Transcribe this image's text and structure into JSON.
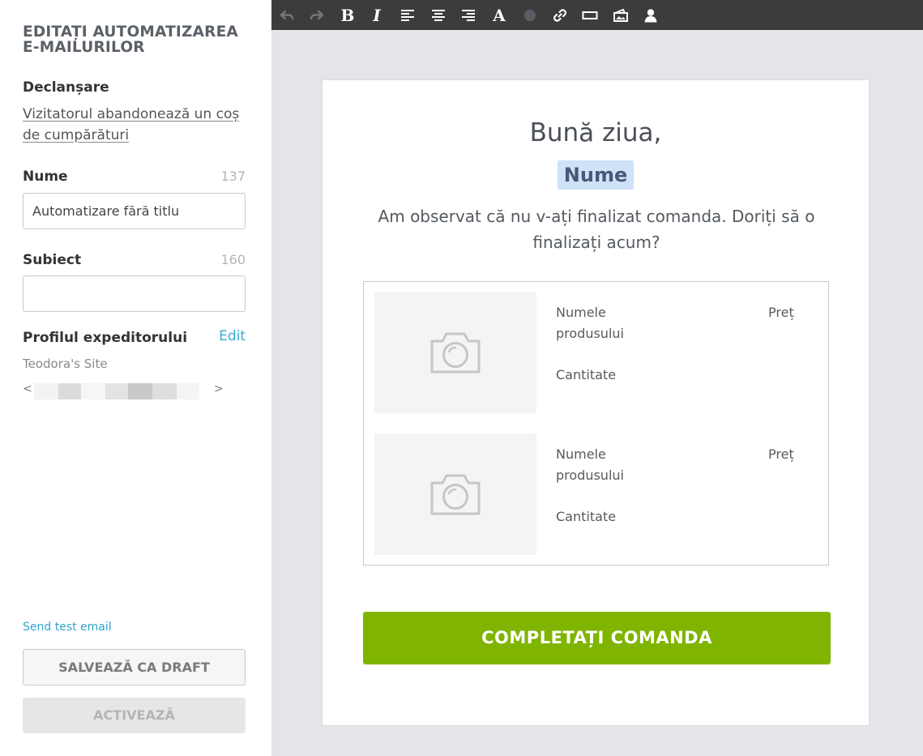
{
  "sidebar": {
    "title": "EDITAȚI AUTOMATIZAREA E-MAILURILOR",
    "trigger_label": "Declanșare",
    "trigger_value": "Vizitatorul abandonează un coș de cumpărături",
    "name_label": "Nume",
    "name_count": "137",
    "name_value": "Automatizare fără titlu",
    "subject_label": "Subiect",
    "subject_count": "160",
    "subject_value": "",
    "sender_label": "Profilul expeditorului",
    "sender_edit": "Edit",
    "sender_name": "Teodora's Site",
    "sender_email_open": "<",
    "sender_email_close": ">",
    "send_test": "Send test email",
    "save_draft": "SALVEAZĂ CA DRAFT",
    "activate": "ACTIVEAZĂ"
  },
  "toolbar": {
    "icons": [
      "undo-icon",
      "redo-icon",
      "bold-icon",
      "italic-icon",
      "align-left-icon",
      "align-center-icon",
      "align-right-icon",
      "font-size-icon",
      "text-color-icon",
      "link-icon",
      "button-icon",
      "image-icon",
      "user-icon"
    ],
    "text_color": "#5a5d63"
  },
  "email": {
    "greeting": "Bună ziua,",
    "name_placeholder": "Nume",
    "message": "Am observat că nu v-ați finalizat comanda. Doriți să o finalizați acum?",
    "products": [
      {
        "name": "Numele produsului",
        "quantity": "Cantitate",
        "price": "Preț"
      },
      {
        "name": "Numele produsului",
        "quantity": "Cantitate",
        "price": "Preț"
      }
    ],
    "cta": "COMPLETAȚI COMANDA"
  },
  "colors": {
    "accent_link": "#3aabd2",
    "cta_green": "#7fb500",
    "toolbar_bg": "#3c3c3c",
    "name_tag_bg": "#cfe2f8"
  }
}
